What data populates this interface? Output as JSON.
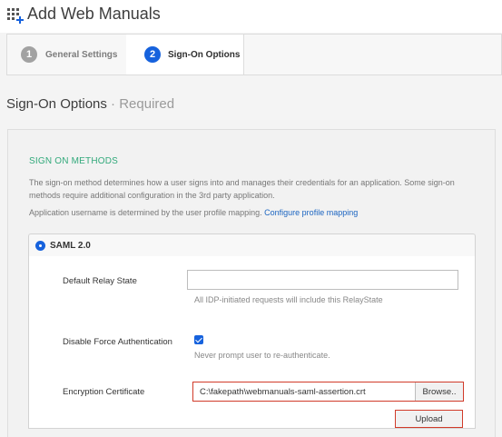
{
  "app": {
    "title": "Add Web Manuals",
    "icon": "grid-plus-icon"
  },
  "steps": [
    {
      "number": "1",
      "label": "General Settings",
      "active": false
    },
    {
      "number": "2",
      "label": "Sign-On Options",
      "active": true
    }
  ],
  "section": {
    "title": "Sign-On Options",
    "required": " · Required"
  },
  "sign_on": {
    "heading": "SIGN ON METHODS",
    "description": "The sign-on method determines how a user signs into and manages their credentials for an application. Some sign-on methods require additional configuration in the 3rd party application.",
    "mapping_text": "Application username is determined by the user profile mapping.",
    "mapping_link": "Configure profile mapping"
  },
  "saml": {
    "label": "SAML 2.0",
    "relay_state": {
      "label": "Default Relay State",
      "value": "",
      "hint": "All IDP-initiated requests will include this RelayState"
    },
    "force_auth": {
      "label": "Disable Force Authentication",
      "checked": true,
      "hint": "Never prompt user to re-authenticate."
    },
    "certificate": {
      "label": "Encryption Certificate",
      "value": "C:\\fakepath\\webmanuals-saml-assertion.crt",
      "browse_label": "Browse..",
      "upload_label": "Upload"
    }
  },
  "colors": {
    "accent": "#1662dd",
    "heading_green": "#32a97b",
    "highlight_red": "#d13b2a",
    "link": "#1c65c1"
  }
}
